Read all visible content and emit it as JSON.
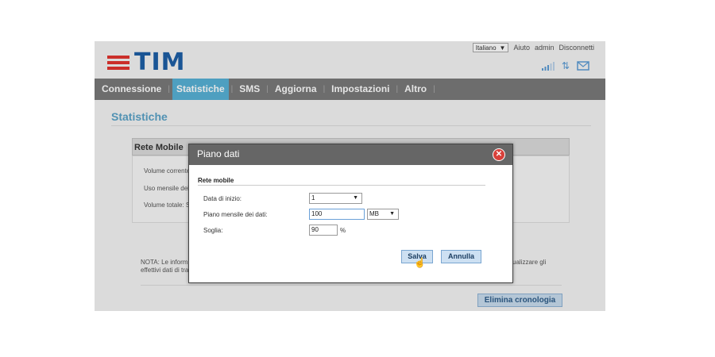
{
  "header": {
    "brand": "TIM",
    "language": "Italiano",
    "links": [
      "Aiuto",
      "admin",
      "Disconnetti"
    ],
    "status_icons": [
      "signal-icon",
      "data-transfer-icon",
      "message-icon"
    ]
  },
  "nav": {
    "items": [
      {
        "label": "Connessione",
        "active": false
      },
      {
        "label": "Statistiche",
        "active": true
      },
      {
        "label": "SMS",
        "active": false
      },
      {
        "label": "Aggiorna",
        "active": false
      },
      {
        "label": "Impostazioni",
        "active": false
      },
      {
        "label": "Altro",
        "active": false
      }
    ]
  },
  "page": {
    "title": "Statistiche",
    "panel_title": "Rete Mobile",
    "stats": [
      "Volume corrente",
      "Uso mensile dei",
      "Volume totale: S"
    ],
    "note_line1": "NOTA: Le inform",
    "note_line2": "effettivi dati di tra",
    "note_right": "ualizzare gli",
    "clear_history_label": "Elimina cronologia"
  },
  "dialog": {
    "title": "Piano dati",
    "section": "Rete mobile",
    "start_date_label": "Data di inizio:",
    "start_date_value": "1",
    "monthly_plan_label": "Piano mensile dei dati:",
    "monthly_plan_value": "100",
    "unit_value": "MB",
    "threshold_label": "Soglia:",
    "threshold_value": "90",
    "threshold_unit": "%",
    "save_label": "Salva",
    "cancel_label": "Annulla"
  },
  "colors": {
    "brand_blue": "#1e5fa6",
    "brand_red": "#e2352f",
    "nav_active": "#57b1d6",
    "nav_bg": "#7a7a7a"
  }
}
